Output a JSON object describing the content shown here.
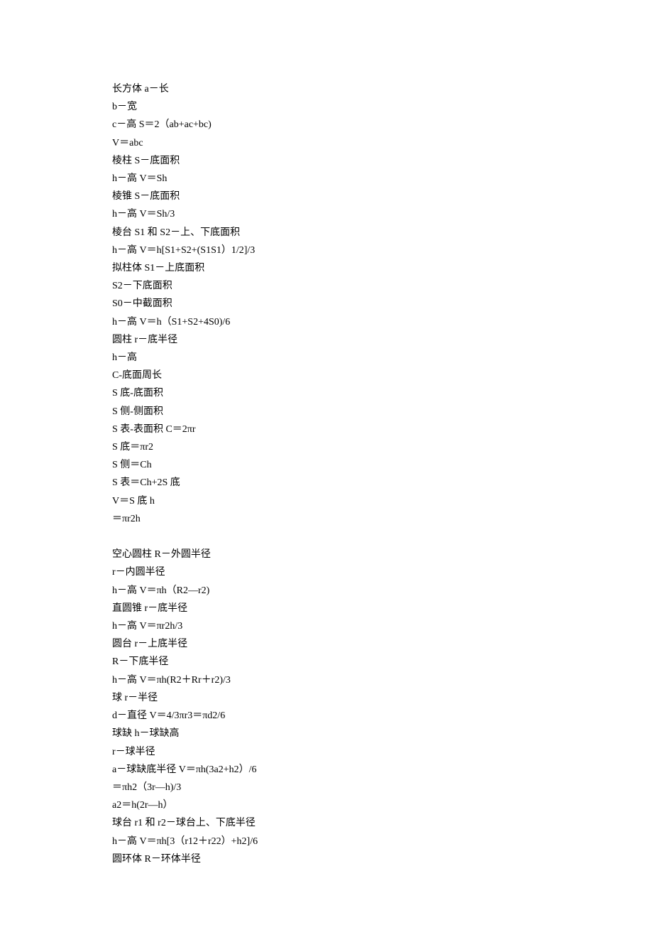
{
  "lines": [
    "长方体 a－长",
    "b－宽",
    "c－高 S＝2（ab+ac+bc)",
    "V＝abc",
    "棱柱 S－底面积",
    "h－高 V＝Sh",
    "棱锥 S－底面积",
    "h－高 V＝Sh/3",
    "棱台 S1 和 S2－上、下底面积",
    "h－高 V＝h[S1+S2+(S1S1）1/2]/3",
    "拟柱体 S1－上底面积",
    "S2－下底面积",
    "S0－中截面积",
    "h－高 V＝h（S1+S2+4S0)/6",
    "圆柱 r－底半径",
    "h－高",
    "C-底面周长",
    "S 底-底面积",
    "S 侧-侧面积",
    "S 表-表面积 C＝2πr",
    "S 底＝πr2",
    "S 侧＝Ch",
    "S 表＝Ch+2S 底",
    "V＝S 底 h",
    "＝πr2h",
    "",
    "空心圆柱 R－外圆半径",
    "r－内圆半径",
    "h－高 V＝πh（R2—r2)",
    "直圆锥 r－底半径",
    "h－高 V＝πr2h/3",
    "圆台 r－上底半径",
    "R－下底半径",
    "h－高 V＝πh(R2＋Rr＋r2)/3",
    "球 r－半径",
    "d－直径 V＝4/3πr3＝πd2/6",
    "球缺 h－球缺高",
    "r－球半径",
    "a－球缺底半径 V＝πh(3a2+h2）/6",
    "＝πh2（3r—h)/3",
    "a2＝h(2r—h）",
    "球台 r1 和 r2－球台上、下底半径",
    "h－高 V＝πh[3（r12＋r22）+h2]/6",
    "圆环体 R－环体半径"
  ]
}
